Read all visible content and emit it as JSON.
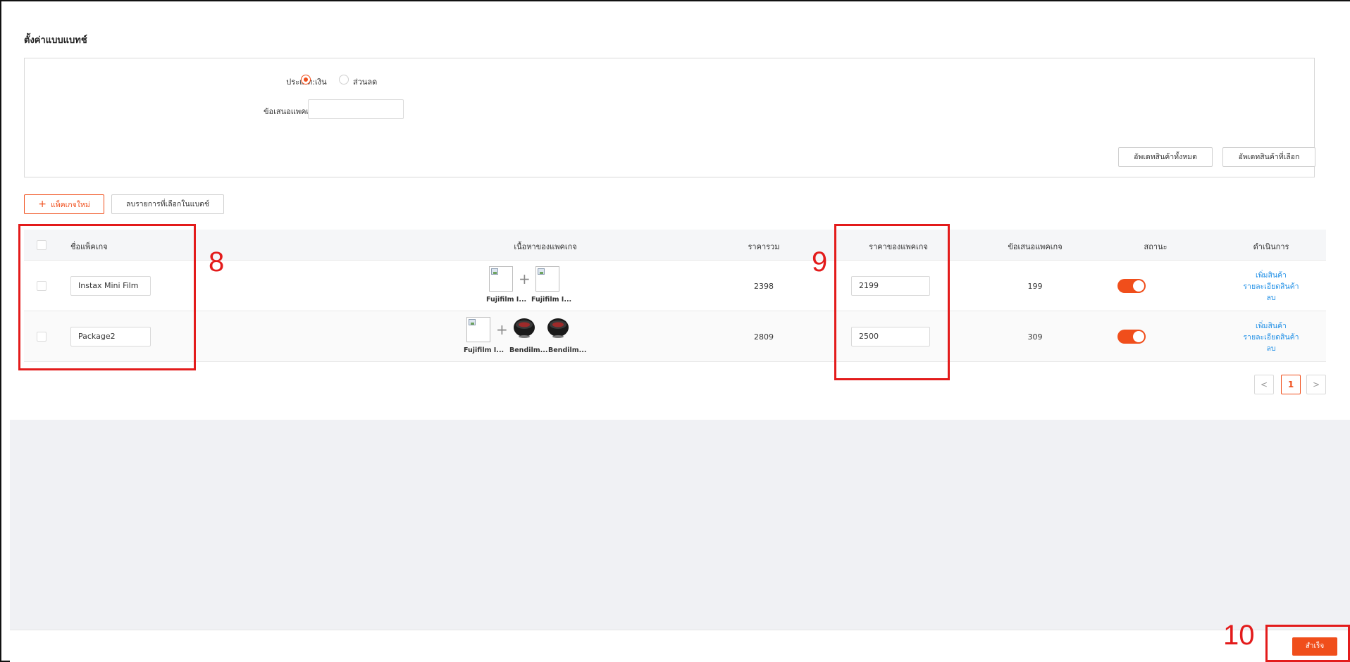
{
  "page": {
    "title": "ตั้งค่าแบบแบทช์"
  },
  "settings": {
    "type_label": "ประเภท:",
    "type_options": [
      {
        "label": "เงิน",
        "checked": true
      },
      {
        "label": "ส่วนลด",
        "checked": false
      }
    ],
    "offer_label": "ข้อเสนอแพคเกจ:",
    "offer_value": "",
    "update_all_label": "อัพเดทสินค้าทั้งหมด",
    "update_selected_label": "อัพเดทสินค้าที่เลือก"
  },
  "toolbar": {
    "new_package_label": "แพ็คเกจใหม่",
    "delete_selected_label": "ลบรายการที่เลือกในแบตช์"
  },
  "table": {
    "headers": {
      "name": "ชื่อแพ็คเกจ",
      "content": "เนื้อหาของแพคเกจ",
      "total": "ราคารวม",
      "package_price": "ราคาของแพคเกจ",
      "offer": "ข้อเสนอแพคเกจ",
      "status": "สถานะ",
      "actions": "ดำเนินการ"
    },
    "rows": [
      {
        "name": "Instax Mini Film",
        "items": [
          {
            "caption": "Fujifilm I...",
            "kind": "broken-image"
          },
          {
            "caption": "Fujifilm I...",
            "kind": "broken-image"
          }
        ],
        "total": "2398",
        "package_price": "2199",
        "offer": "199",
        "status_on": true,
        "actions": {
          "add": "เพิ่มสินค้า",
          "detail": "รายละเอียดสินค้า",
          "delete": "ลบ"
        }
      },
      {
        "name": "Package2",
        "items": [
          {
            "caption": "Fujifilm I...",
            "kind": "broken-image"
          },
          {
            "caption": "Bendilm...",
            "kind": "bowl"
          },
          {
            "caption": "Bendilm...",
            "kind": "bowl"
          }
        ],
        "total": "2809",
        "package_price": "2500",
        "offer": "309",
        "status_on": true,
        "actions": {
          "add": "เพิ่มสินค้า",
          "detail": "รายละเอียดสินค้า",
          "delete": "ลบ"
        }
      }
    ]
  },
  "pagination": {
    "prev": "<",
    "current": "1",
    "next": ">"
  },
  "annotations": {
    "n8": "8",
    "n9": "9",
    "n10": "10"
  },
  "footer": {
    "success_label": "สำเร็จ"
  },
  "colors": {
    "accent": "#f04e1b",
    "link": "#1f8fe6",
    "annotation": "#e31b1b"
  }
}
